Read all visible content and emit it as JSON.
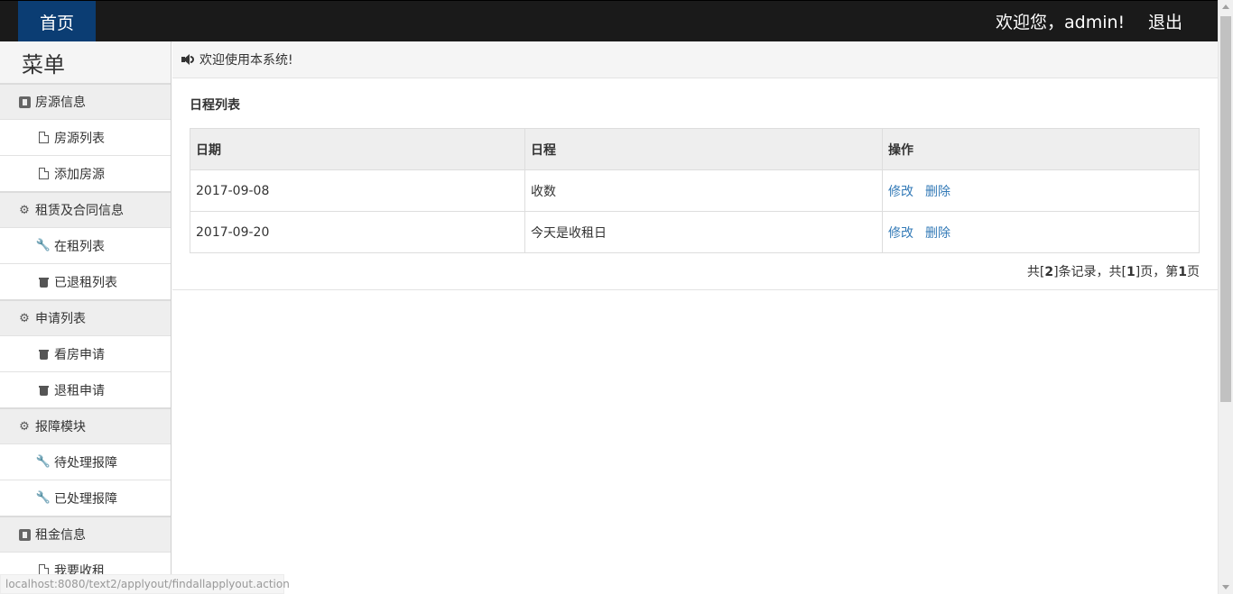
{
  "header": {
    "home_label": "首页",
    "welcome": "欢迎您，admin!",
    "logout": "退出"
  },
  "sidebar": {
    "title": "菜单",
    "groups": [
      {
        "label": "房源信息",
        "icon": "square-icon",
        "items": [
          {
            "label": "房源列表",
            "icon": "file-icon"
          },
          {
            "label": "添加房源",
            "icon": "file-icon"
          }
        ]
      },
      {
        "label": "租赁及合同信息",
        "icon": "gear-icon",
        "items": [
          {
            "label": "在租列表",
            "icon": "wrench-icon"
          },
          {
            "label": "已退租列表",
            "icon": "trash-icon"
          }
        ]
      },
      {
        "label": "申请列表",
        "icon": "gear-icon",
        "items": [
          {
            "label": "看房申请",
            "icon": "trash-icon"
          },
          {
            "label": "退租申请",
            "icon": "trash-icon"
          }
        ]
      },
      {
        "label": "报障模块",
        "icon": "gear-icon",
        "items": [
          {
            "label": "待处理报障",
            "icon": "wrench-icon"
          },
          {
            "label": "已处理报障",
            "icon": "wrench-icon"
          }
        ]
      },
      {
        "label": "租金信息",
        "icon": "square-icon",
        "items": [
          {
            "label": "我要收租",
            "icon": "file-icon"
          }
        ]
      }
    ]
  },
  "status_url": "localhost:8080/text2/applyout/findallapplyout.action",
  "notice": "欢迎使用本系统!",
  "schedule": {
    "title": "日程列表",
    "columns": [
      "日期",
      "日程",
      "操作"
    ],
    "rows": [
      {
        "date": "2017-09-08",
        "event": "收数",
        "edit": "修改",
        "delete": "删除"
      },
      {
        "date": "2017-09-20",
        "event": "今天是收租日",
        "edit": "修改",
        "delete": "删除"
      }
    ],
    "pager": {
      "prefix": "共[",
      "total": "2",
      "mid1": "]条记录，共[",
      "pages": "1",
      "mid2": "]页，第",
      "current": "1",
      "suffix": "页"
    }
  },
  "colors": {
    "topbar": "#1a1a1a",
    "home_tab": "#0b3d73",
    "link": "#337ab7"
  }
}
